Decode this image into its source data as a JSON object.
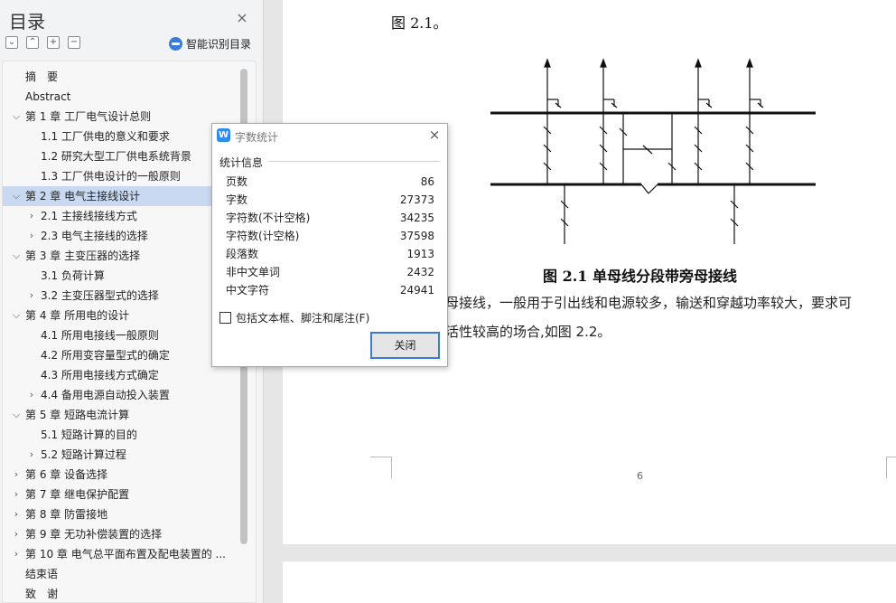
{
  "toc": {
    "title": "目录",
    "smart_toc_label": "智能识别目录",
    "items": [
      {
        "label": "摘　要",
        "level": 0,
        "chevron": ""
      },
      {
        "label": "Abstract",
        "level": 0,
        "chevron": ""
      },
      {
        "label": "第 1 章  工厂电气设计总则",
        "level": 0,
        "chevron": "v"
      },
      {
        "label": "1.1 工厂供电的意义和要求",
        "level": 1,
        "chevron": ""
      },
      {
        "label": "1.2  研究大型工厂供电系统背景",
        "level": 1,
        "chevron": ""
      },
      {
        "label": "1.3  工厂供电设计的一般原则",
        "level": 1,
        "chevron": ""
      },
      {
        "label": "第 2 章  电气主接线设计",
        "level": 0,
        "chevron": "v",
        "selected": true
      },
      {
        "label": "2.1  主接线接线方式",
        "level": 1,
        "chevron": ">"
      },
      {
        "label": "2.3  电气主接线的选择",
        "level": 1,
        "chevron": ">"
      },
      {
        "label": "第 3 章  主变压器的选择",
        "level": 0,
        "chevron": "v"
      },
      {
        "label": "3.1 负荷计算",
        "level": 1,
        "chevron": ""
      },
      {
        "label": "3.2  主变压器型式的选择",
        "level": 1,
        "chevron": ">"
      },
      {
        "label": "第 4 章  所用电的设计",
        "level": 0,
        "chevron": "v"
      },
      {
        "label": "4.1  所用电接线一般原则",
        "level": 1,
        "chevron": ""
      },
      {
        "label": "4.2  所用变容量型式的确定",
        "level": 1,
        "chevron": ""
      },
      {
        "label": "4.3  所用电接线方式确定",
        "level": 1,
        "chevron": ""
      },
      {
        "label": "4.4  备用电源自动投入装置",
        "level": 1,
        "chevron": ">"
      },
      {
        "label": "第 5 章  短路电流计算",
        "level": 0,
        "chevron": "v"
      },
      {
        "label": "5.1  短路计算的目的",
        "level": 1,
        "chevron": ""
      },
      {
        "label": "5.2  短路计算过程",
        "level": 1,
        "chevron": ">"
      },
      {
        "label": "第 6 章  设备选择",
        "level": 0,
        "chevron": ">"
      },
      {
        "label": "第 7 章  继电保护配置",
        "level": 0,
        "chevron": ">"
      },
      {
        "label": "第 8 章  防雷接地",
        "level": 0,
        "chevron": ">"
      },
      {
        "label": "第 9 章  无功补偿装置的选择",
        "level": 0,
        "chevron": ">"
      },
      {
        "label": "第 10 章  电气总平面布置及配电装置的 ...",
        "level": 0,
        "chevron": ">"
      },
      {
        "label": "结束语",
        "level": 0,
        "chevron": ""
      },
      {
        "label": "致　谢",
        "level": 0,
        "chevron": ""
      }
    ]
  },
  "document": {
    "fig_ref": "图 2.1。",
    "figure_caption": "图 2.1 单母线分段带旁母接线",
    "body_line1": "母接线，一般用于引出线和电源较多，输送和穿越功率较大，要求可",
    "body_line2": "活性较高的场合,如图 2.2。",
    "page_number": "6"
  },
  "word_count_dialog": {
    "title": "字数统计",
    "section_label": "统计信息",
    "stats": [
      {
        "label": "页数",
        "value": "86"
      },
      {
        "label": "字数",
        "value": "27373"
      },
      {
        "label": "字符数(不计空格)",
        "value": "34235"
      },
      {
        "label": "字符数(计空格)",
        "value": "37598"
      },
      {
        "label": "段落数",
        "value": "1913"
      },
      {
        "label": "非中文单词",
        "value": "2432"
      },
      {
        "label": "中文字符",
        "value": "24941"
      }
    ],
    "checkbox_label": "包括文本框、脚注和尾注(F)",
    "checkbox_checked": false,
    "close_button": "关闭"
  },
  "colors": {
    "selected_row": "#c9d9f2",
    "accent": "#3b7bd4",
    "app_icon": "#2d8cf0"
  }
}
